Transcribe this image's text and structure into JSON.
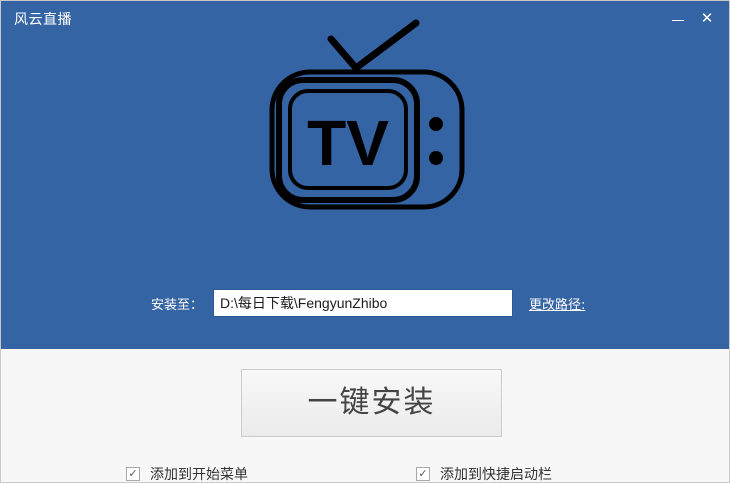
{
  "window": {
    "title": "风云直播",
    "minimize_icon": "minimize-icon",
    "close_glyph": "✕",
    "brand_color": "#3464a4"
  },
  "logo": {
    "icon": "tv-icon",
    "text": "TV"
  },
  "install": {
    "label": "安装至：",
    "path_value": "D:\\每日下载\\FengyunZhibo",
    "change_path_link": "更改路径:",
    "button_label": "一键安装"
  },
  "options": [
    {
      "label": "添加到开始菜单",
      "checked": true
    },
    {
      "label": "添加到快捷启动栏",
      "checked": true
    }
  ],
  "check_glyph": "✓"
}
